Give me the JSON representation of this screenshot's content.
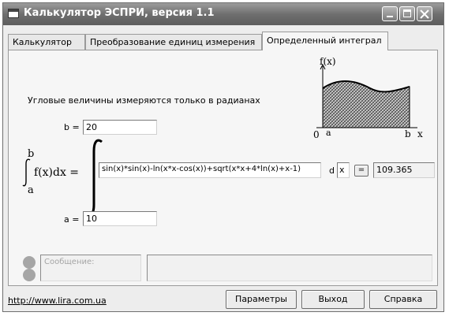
{
  "window": {
    "title": "Калькулятор ЭСПРИ, версия 1.1"
  },
  "tabs": [
    {
      "label": "Калькулятор",
      "active": false
    },
    {
      "label": "Преобразование единиц измерения",
      "active": false
    },
    {
      "label": "Определенный интеграл",
      "active": true
    }
  ],
  "panel": {
    "note": "Угловые величины измеряются только в радианах",
    "b_label": "b =",
    "b_value": "20",
    "a_label": "a =",
    "a_value": "10",
    "integral": {
      "upper": "b",
      "lower": "a",
      "lhs": "f(x)dx =",
      "expression": "sin(x)*sin(x)-ln(x*x-cos(x))+sqrt(x*x+4*ln(x)+x-1)",
      "d_label": "d",
      "variable": "x",
      "equals_button": "=",
      "result": "109.365"
    },
    "graph": {
      "y_label": "f(x)",
      "x_label": "x",
      "origin": "0",
      "a_mark": "a",
      "b_mark": "b",
      "fill_color": "#5a5a5a"
    },
    "message_placeholder": "Сообщение:"
  },
  "footer": {
    "link": "http://www.lira.com.ua",
    "buttons": {
      "params": "Параметры",
      "exit": "Выход",
      "help": "Справка"
    }
  },
  "colors": {
    "titlebar": "#6f6f6f",
    "panel": "#f6f6f6",
    "led": "#a6a6a6"
  }
}
